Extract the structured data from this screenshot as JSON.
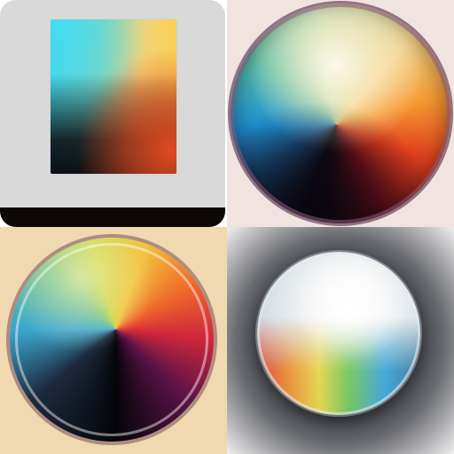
{
  "grid": {
    "tiles": [
      {
        "icon": "gradient-square-icon",
        "background": "#ffffff",
        "card_color": "#d9d9d9",
        "colors": [
          "#40d6ec",
          "#f7d056",
          "#e94c22",
          "#08060a"
        ]
      },
      {
        "icon": "gradient-orb-icon",
        "background": "#f1e3e0",
        "colors": [
          "#1f8fd0",
          "#5cc2a8",
          "#f59a32",
          "#e2421e",
          "#0c0a10"
        ]
      },
      {
        "icon": "gradient-orb-icon",
        "background": "#f0d8b0",
        "colors": [
          "#3aa7d0",
          "#6cc18a",
          "#f2c13c",
          "#d1283a",
          "#050509"
        ]
      },
      {
        "icon": "glass-bubble-icon",
        "background": "#1c1d22",
        "colors": [
          "#e2362a",
          "#e9d43c",
          "#6fc54a",
          "#2c9fd6",
          "#ffffff"
        ]
      }
    ]
  }
}
